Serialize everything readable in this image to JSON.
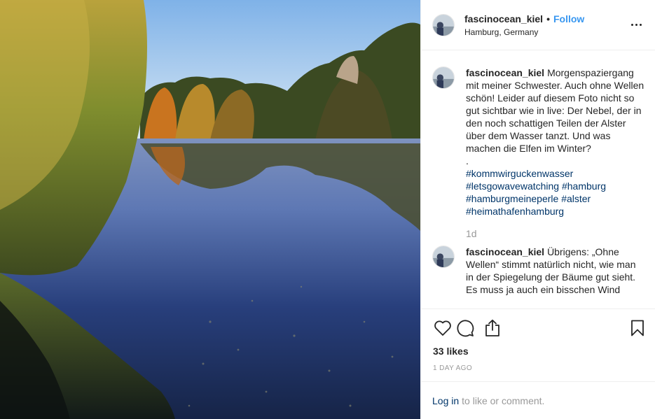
{
  "post": {
    "username": "fascinocean_kiel",
    "separator": "•",
    "follow_label": "Follow",
    "location": "Hamburg, Germany",
    "more_icon": "more-horizontal-icon"
  },
  "caption": {
    "username": "fascinocean_kiel",
    "text": "Morgenspaziergang mit meiner Schwester. Auch ohne Wellen schön! Leider auf diesem Foto nicht so gut sichtbar wie in live: Der Nebel, der in den noch schattigen Teilen der Alster über dem Wasser tanzt. Und was machen die Elfen im Winter?\n.",
    "hashtags_line1": "#kommwirguckenwasser",
    "hashtags_line2": "#letsgowavewatching #hamburg",
    "hashtags_line3": "#hamburgmeineperle #alster",
    "hashtags_line4": "#heimathafenhamburg",
    "time": "1d"
  },
  "comment2": {
    "username": "fascinocean_kiel",
    "text": "Übrigens: „Ohne Wellen“ stimmt natürlich nicht, wie man in der Spiegelung der Bäume gut sieht. Es muss ja auch ein bisschen Wind"
  },
  "actions": {
    "like_icon": "heart-icon",
    "comment_icon": "comment-icon",
    "share_icon": "share-icon",
    "save_icon": "bookmark-icon"
  },
  "likes_label": "33 likes",
  "age_label": "1 day ago",
  "login": {
    "link_label": "Log in",
    "rest_label": "to like or comment."
  },
  "colors": {
    "link_blue": "#3897f0",
    "hashtag_blue": "#003569",
    "muted_gray": "#999999",
    "border": "#efefef"
  }
}
